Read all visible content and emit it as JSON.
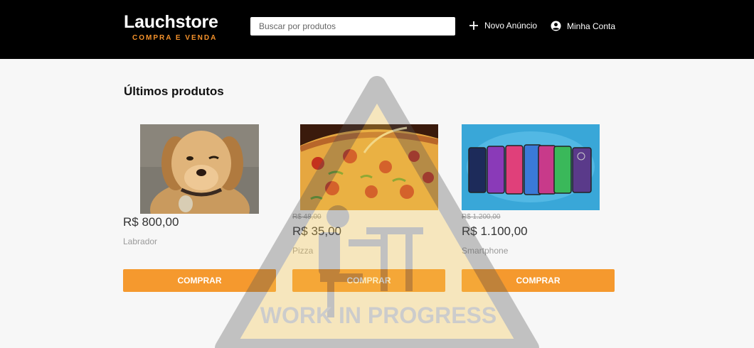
{
  "header": {
    "logo_title": "Lauchstore",
    "logo_subtitle": "COMPRA E VENDA",
    "search_placeholder": "Buscar por produtos",
    "new_ad_label": "Novo Anúncio",
    "account_label": "Minha Conta"
  },
  "main": {
    "section_title": "Últimos produtos",
    "products": [
      {
        "old_price": "",
        "price": "R$ 800,00",
        "name": "Labrador",
        "buy_label": "COMPRAR",
        "image_icon": "dog-photo"
      },
      {
        "old_price": "R$ 48,00",
        "price": "R$ 35,00",
        "name": "Pizza",
        "buy_label": "COMPRAR",
        "image_icon": "pizza-photo"
      },
      {
        "old_price": "R$ 1.200,00",
        "price": "R$ 1.100,00",
        "name": "Smartphone",
        "buy_label": "COMPRAR",
        "image_icon": "smartphones-photo"
      }
    ]
  },
  "watermark": {
    "text": "WORK IN PROGRESS"
  },
  "colors": {
    "header_bg": "#000000",
    "accent": "#f5992e",
    "page_bg": "#f7f7f7"
  }
}
